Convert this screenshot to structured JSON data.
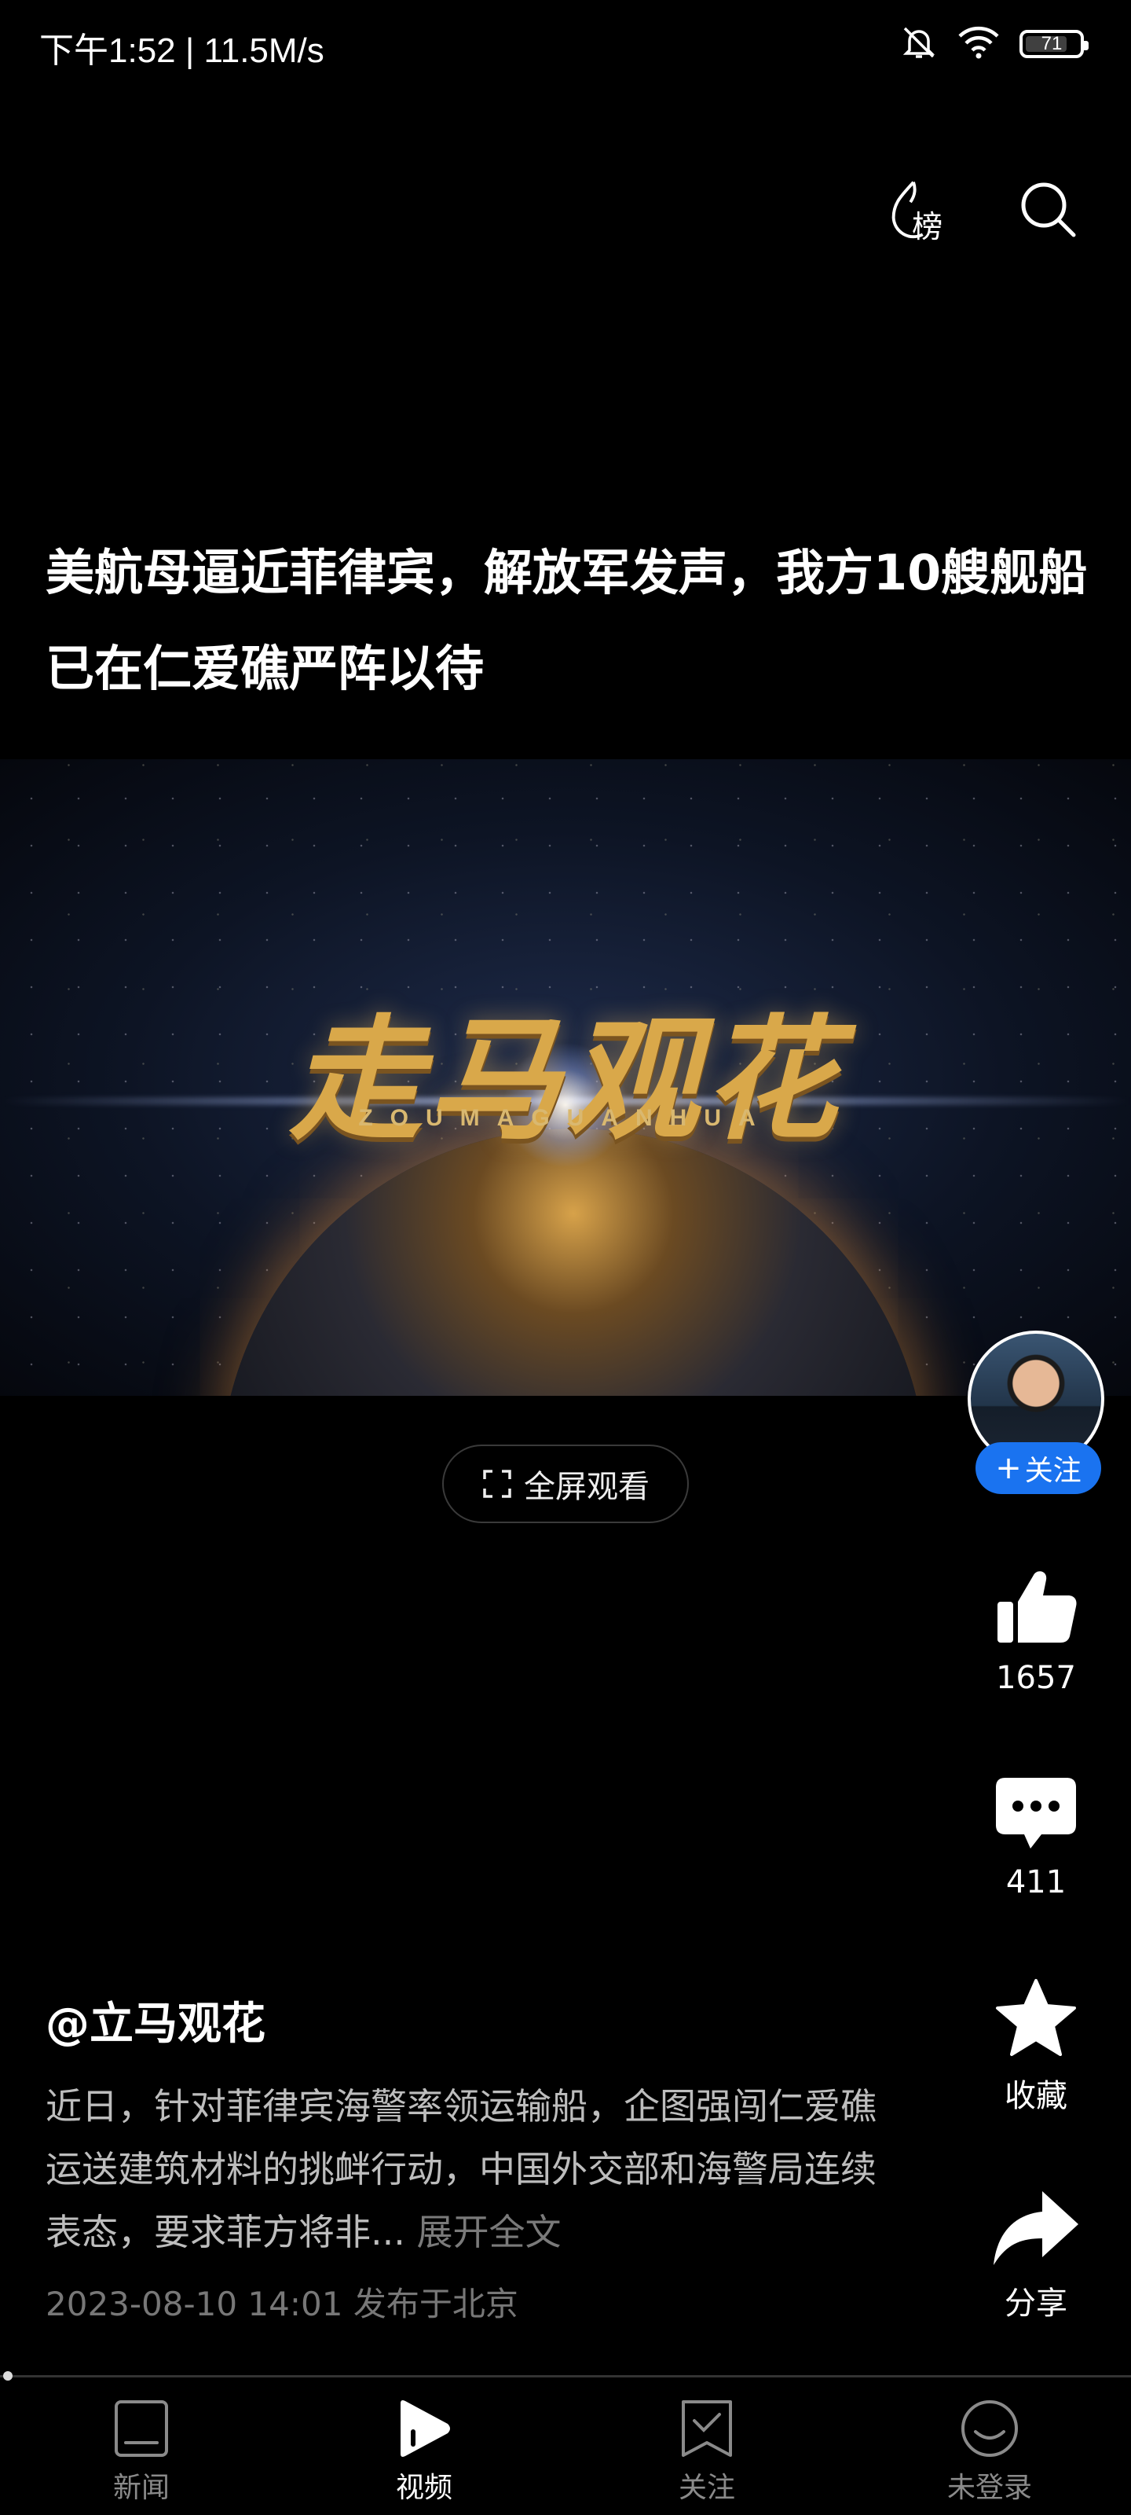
{
  "status": {
    "time": "下午1:52 | 11.5M/s",
    "battery": "71",
    "icons": [
      "mute-bell-icon",
      "wifi-icon",
      "battery-icon"
    ]
  },
  "top_actions": {
    "rank_label": "榜",
    "icons": [
      "hot-rank-icon",
      "search-icon"
    ]
  },
  "headline": "美航母逼近菲律宾，解放军发声，我方10艘舰船已在仁爱礁严阵以待",
  "video": {
    "logo_text": "走马观花",
    "logo_sub": "ZOUMAGUANHUA"
  },
  "fullscreen": {
    "label": "全屏观看"
  },
  "follow": {
    "label": "关注"
  },
  "actions": {
    "like_count": "1657",
    "comment_count": "411",
    "favorite_label": "收藏",
    "share_label": "分享"
  },
  "post": {
    "author": "@立马观花",
    "description": "近日，针对菲律宾海警率领运输船，企图强闯仁爱礁运送建筑材料的挑衅行动，中国外交部和海警局连续表态，要求菲方将非...",
    "expand_label": "展开全文",
    "published": "2023-08-10 14:01 发布于北京"
  },
  "progress": {
    "value": 0.0
  },
  "tabs": [
    {
      "label": "新闻",
      "icon": "news-icon",
      "active": false
    },
    {
      "label": "视频",
      "icon": "video-play-icon",
      "active": true
    },
    {
      "label": "关注",
      "icon": "follow-icon",
      "active": false
    },
    {
      "label": "未登录",
      "icon": "user-icon",
      "active": false
    }
  ],
  "colors": {
    "accent": "#1a73f0",
    "background": "#000000"
  }
}
